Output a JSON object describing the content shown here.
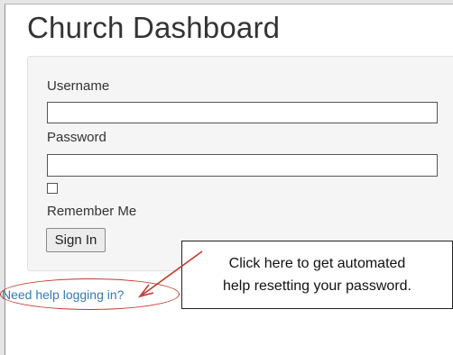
{
  "page": {
    "title": "Church Dashboard"
  },
  "login_form": {
    "username_label": "Username",
    "username_value": "",
    "password_label": "Password",
    "password_value": "",
    "remember_me_label": "Remember Me",
    "remember_me_checked": false,
    "sign_in_label": "Sign In"
  },
  "help": {
    "link_text": "Need help logging in?"
  },
  "annotation": {
    "line1": "Click here to get automated",
    "line2": "help resetting your password.",
    "color": "#c0392b"
  }
}
